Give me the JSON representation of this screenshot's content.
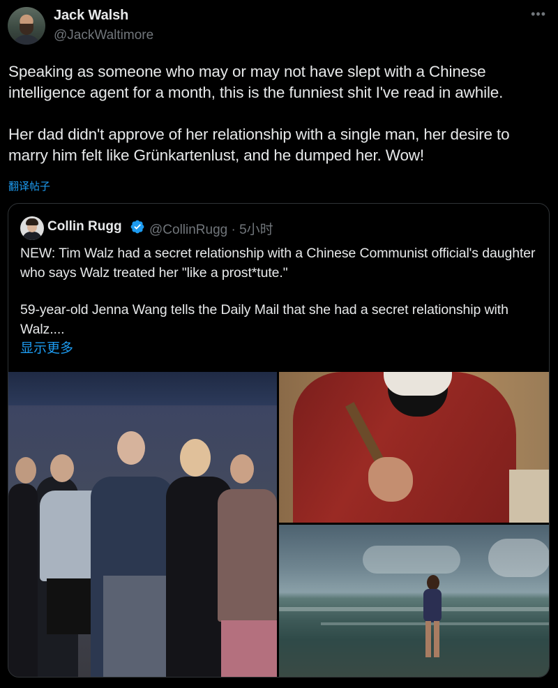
{
  "author": {
    "display_name": "Jack Walsh",
    "handle": "@JackWaltimore"
  },
  "more_icon": "more-horizontal-icon",
  "tweet": {
    "paragraph_1": "Speaking as someone who may or may not have slept with a Chinese intelligence agent for a month, this is the funniest shit I've read in awhile.",
    "paragraph_2": "Her dad didn't approve of her relationship with a single man, her desire to marry him felt like Grünkartenlust, and he dumped her. Wow!",
    "translate_label": "翻译帖子"
  },
  "quoted": {
    "display_name": "Collin Rugg",
    "verified_icon": "verified-badge-icon",
    "handle_time": "@CollinRugg · 5小时",
    "paragraph_1": "NEW: Tim Walz had a secret relationship with a Chinese Communist official's daughter who says Walz treated her \"like a prost*tute.\"",
    "paragraph_2": "59-year-old Jenna Wang tells the Daily Mail that she had a secret relationship with Walz....",
    "show_more_label": "显示更多"
  },
  "colors": {
    "background": "#000000",
    "text": "#e7e9ea",
    "muted": "#71767b",
    "link": "#1d9bf0",
    "border": "#2f3336",
    "verified": "#1d9bf0"
  }
}
